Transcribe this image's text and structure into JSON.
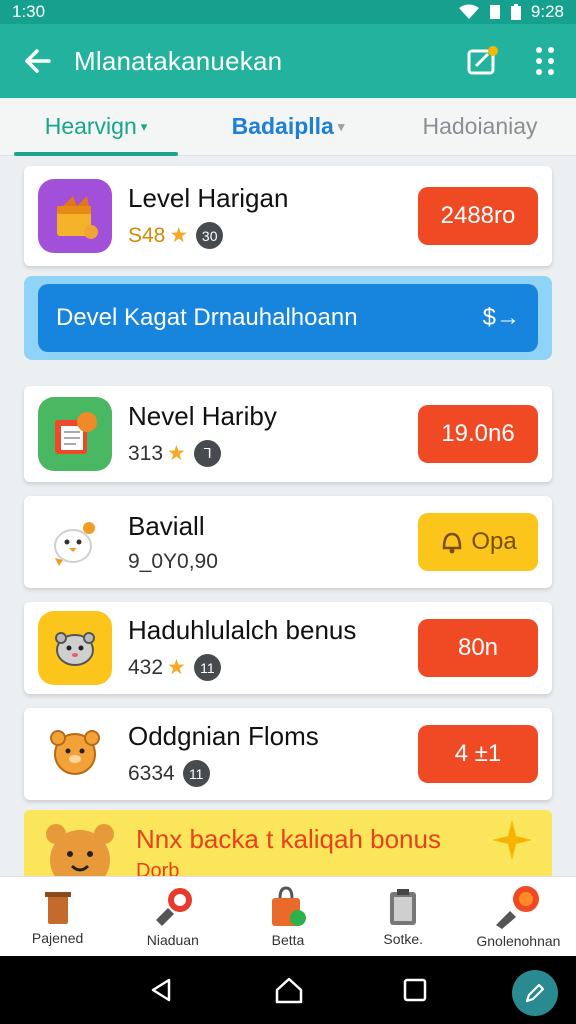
{
  "status_bar": {
    "time": "1:30",
    "clock_right": "9:28",
    "icons": [
      "wifi-icon",
      "sim-icon",
      "battery-icon"
    ]
  },
  "app_bar": {
    "title": "Mlanatakanuekan",
    "icons": [
      "back-arrow-icon",
      "edit-badge-icon",
      "grid-menu-icon"
    ]
  },
  "tabs": [
    {
      "label": "Hearvign",
      "active": true,
      "has_caret": true
    },
    {
      "label": "Badaiplla",
      "active": false,
      "has_caret": true
    },
    {
      "label": "Hadoianiay",
      "active": false,
      "has_caret": false
    }
  ],
  "items": [
    {
      "title": "Level Harigan",
      "meta": "S48",
      "badge": "30",
      "price": "2488ro",
      "price_style": "red",
      "icon": "gift-box-icon"
    },
    {
      "title": "Nevel Hariby",
      "meta": "313",
      "badge": "ᒣ",
      "price": "19.0n6",
      "price_style": "red",
      "icon": "book-fox-icon"
    },
    {
      "title": "Baviall",
      "meta": "9_0Y0,90",
      "badge": "",
      "price": "Opa",
      "price_style": "yellow",
      "icon": "chick-icon"
    },
    {
      "title": "Haduhlulalch benus",
      "meta": "432",
      "badge": "11",
      "price": "80n",
      "price_style": "red",
      "icon": "hamster-icon"
    },
    {
      "title": "Oddgnian Floms",
      "meta": "6334",
      "badge": "11",
      "price": "4  ±1",
      "price_style": "red",
      "icon": "bear-icon"
    }
  ],
  "banner": {
    "text": "Devel Kagat Drnauhalhoann",
    "icon": "$→"
  },
  "promo": {
    "line1": "Nnx backa t kaliqah bonus",
    "line2": "Dorb"
  },
  "bottom_nav": [
    {
      "label": "Pajened",
      "icon": "trash-can-icon"
    },
    {
      "label": "Niaduan",
      "icon": "pin-badge-icon"
    },
    {
      "label": "Betta",
      "icon": "shopping-bag-icon"
    },
    {
      "label": "Sotke.",
      "icon": "clipboard-icon"
    },
    {
      "label": "Gnolenohnan",
      "icon": "notification-brush-icon"
    }
  ],
  "colors": {
    "teal": "#22b29e",
    "blue": "#1784dd",
    "red": "#f04a24",
    "yellow": "#fcc51c"
  }
}
